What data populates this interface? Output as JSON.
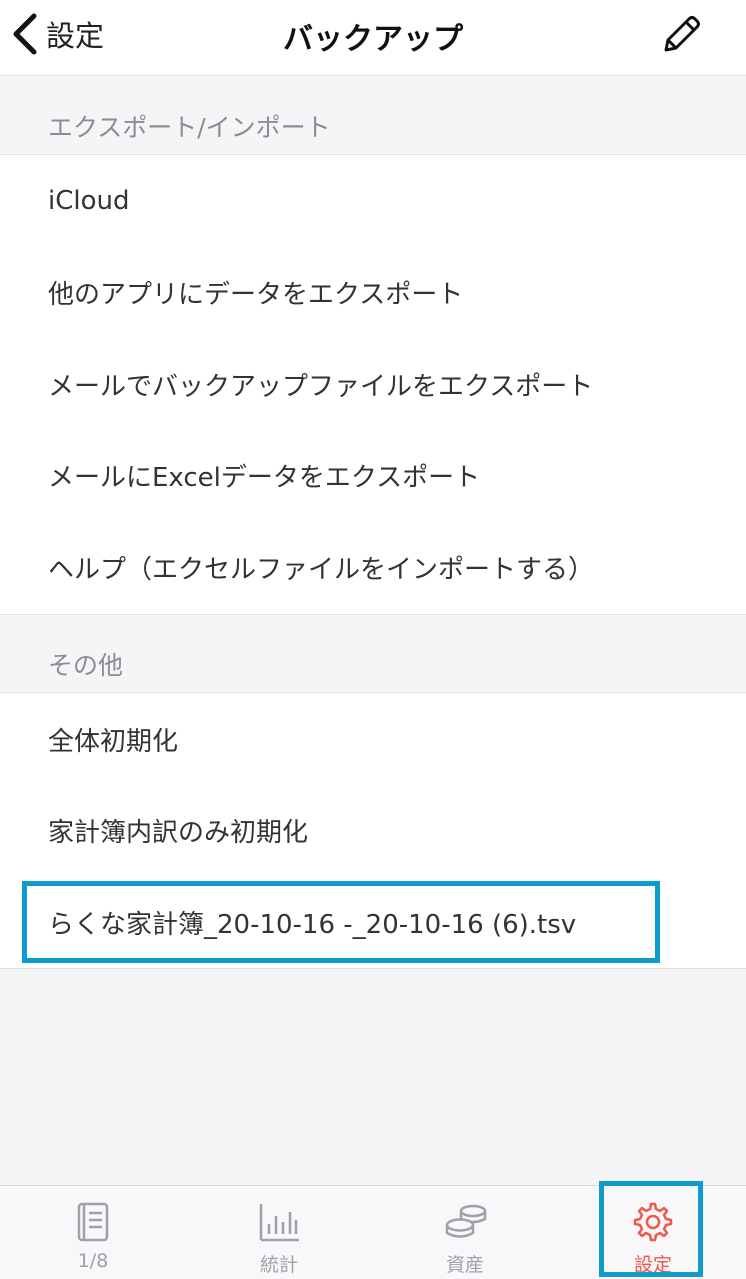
{
  "nav": {
    "back_label": "設定",
    "title": "バックアップ",
    "edit_icon": "pencil-icon"
  },
  "sections": [
    {
      "header": "エクスポート/インポート",
      "items": [
        "iCloud",
        "他のアプリにデータをエクスポート",
        "メールでバックアップファイルをエクスポート",
        "メールにExcelデータをエクスポート",
        "ヘルプ（エクセルファイルをインポートする）"
      ]
    },
    {
      "header": "その他",
      "items": [
        "全体初期化",
        "家計簿内訳のみ初期化",
        "らくな家計簿_20-10-16 -_20-10-16 (6).tsv"
      ]
    }
  ],
  "tabbar": {
    "tabs": [
      {
        "label": "1/8",
        "icon": "book-icon"
      },
      {
        "label": "統計",
        "icon": "bar-chart-icon"
      },
      {
        "label": "資産",
        "icon": "coins-icon"
      },
      {
        "label": "設定",
        "icon": "gear-icon",
        "active": true
      }
    ]
  },
  "colors": {
    "accent": "#f0584c",
    "highlight": "#0e9ccb"
  }
}
